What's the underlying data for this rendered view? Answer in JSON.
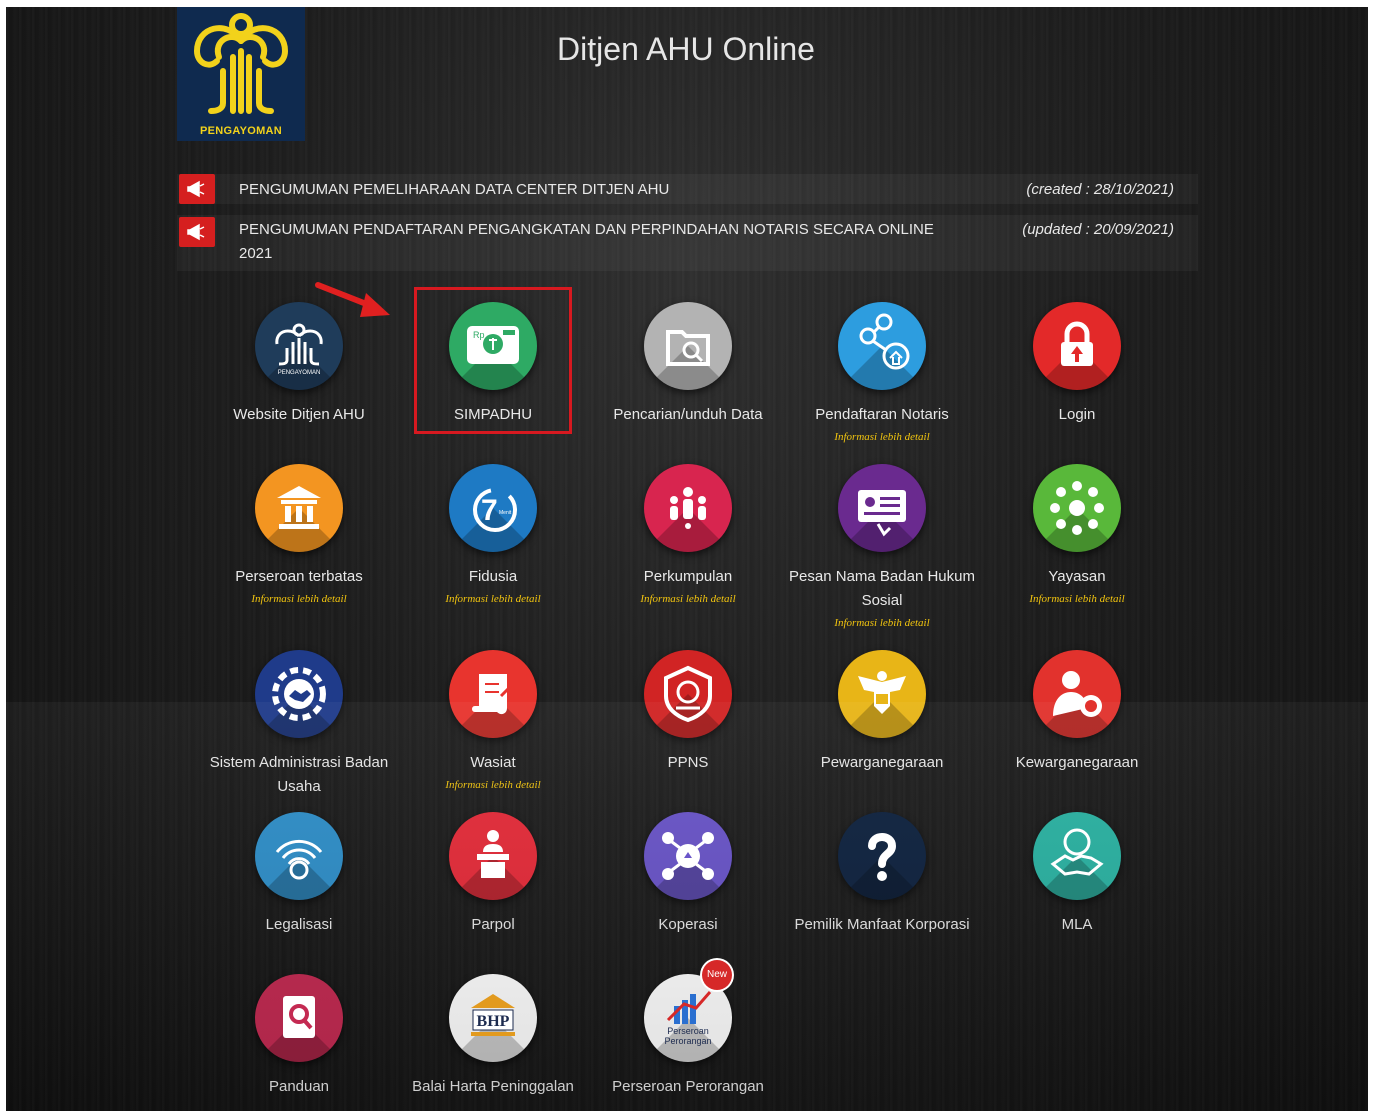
{
  "header": {
    "logo_text": "PENGAYOMAN",
    "title": "Ditjen AHU Online"
  },
  "announcements": [
    {
      "text": "PENGUMUMAN PEMELIHARAAN DATA CENTER DITJEN AHU",
      "date": "(created : 28/10/2021)"
    },
    {
      "text": "PENGUMUMAN PENDAFTARAN PENGANGKATAN DAN PERPINDAHAN NOTARIS SECARA ONLINE 2021",
      "date": "(updated : 20/09/2021)"
    }
  ],
  "services": [
    {
      "label": "Website Ditjen AHU",
      "icon": "pengayoman-logo-icon",
      "color": "#1f3c5a"
    },
    {
      "label": "SIMPADHU",
      "icon": "payment-card-icon",
      "color": "#2eaa64"
    },
    {
      "label": "Pencarian/unduh Data",
      "icon": "folder-search-icon",
      "color": "#b3b3b3"
    },
    {
      "label": "Pendaftaran Notaris",
      "info": "Informasi lebih detail",
      "icon": "network-icon",
      "color": "#2d9ddf"
    },
    {
      "label": "Login",
      "icon": "lock-icon",
      "color": "#e32929"
    },
    {
      "label": "Perseroan terbatas",
      "info": "Informasi lebih detail",
      "icon": "building-icon",
      "color": "#f39521"
    },
    {
      "label": "Fidusia",
      "info": "Informasi lebih detail",
      "icon": "stopwatch-icon",
      "color": "#1e7ac4",
      "icon_text": "Menit"
    },
    {
      "label": "Perkumpulan",
      "info": "Informasi lebih detail",
      "icon": "people-group-icon",
      "color": "#d8254f"
    },
    {
      "label": "Pesan Nama Badan Hukum Sosial",
      "info": "Informasi lebih detail",
      "icon": "id-card-icon",
      "color": "#6a2a8f"
    },
    {
      "label": "Yayasan",
      "info": "Informasi lebih detail",
      "icon": "hands-circle-icon",
      "color": "#59b83a"
    },
    {
      "label": "Sistem Administrasi Badan Usaha",
      "icon": "gear-handshake-icon",
      "color": "#1f3b8a"
    },
    {
      "label": "Wasiat",
      "info": "Informasi lebih detail",
      "icon": "scroll-icon",
      "color": "#e8342e"
    },
    {
      "label": "PPNS",
      "icon": "badge-shield-icon",
      "color": "#d12424"
    },
    {
      "label": "Pewarganegaraan",
      "icon": "garuda-icon",
      "color": "#e8b517"
    },
    {
      "label": "Kewarganegaraan",
      "icon": "person-flag-icon",
      "color": "#e2322d"
    },
    {
      "label": "Legalisasi",
      "icon": "globe-signal-icon",
      "color": "#2f8fc9"
    },
    {
      "label": "Parpol",
      "icon": "podium-speaker-icon",
      "color": "#e62c3a"
    },
    {
      "label": "Koperasi",
      "icon": "cooperative-icon",
      "color": "#6a55c9"
    },
    {
      "label": "Pemilik Manfaat Korporasi",
      "icon": "question-mark-icon",
      "color": "#0f2340"
    },
    {
      "label": "MLA",
      "icon": "globe-handshake-icon",
      "color": "#2bb3a3"
    },
    {
      "label": "Panduan",
      "icon": "book-search-icon",
      "color": "#c42a52"
    },
    {
      "label": "Balai Harta Peninggalan",
      "icon": "bhp-building-icon",
      "color": "#ffffff",
      "icon_text": "BHP"
    },
    {
      "label": "Perseroan Perorangan",
      "icon": "chart-buildings-icon",
      "color": "#ffffff",
      "icon_text": "Perseroan Perorangan",
      "badge": "New"
    }
  ]
}
